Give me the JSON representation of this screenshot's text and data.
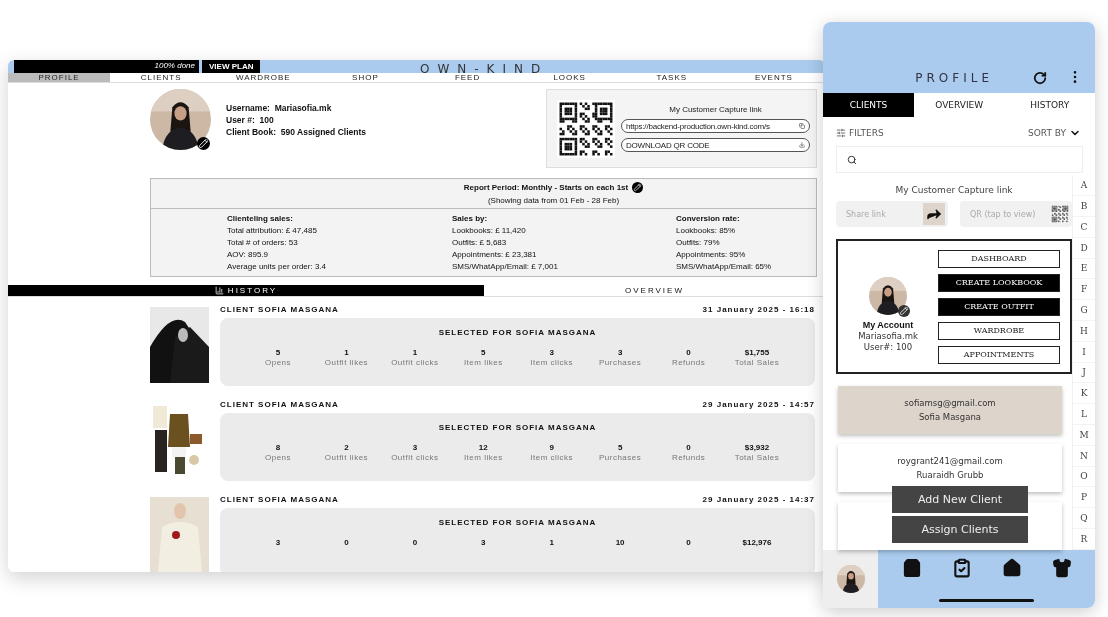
{
  "desktop": {
    "progress": {
      "label": "100% done",
      "level": 1
    },
    "view_plan": "VIEW PLAN",
    "logo": "OWN-KIND",
    "nav": [
      {
        "label": "PROFILE",
        "selected": true
      },
      {
        "label": "CLIENTS",
        "selected": false
      },
      {
        "label": "WARDROBE",
        "selected": false
      },
      {
        "label": "SHOP",
        "selected": false
      },
      {
        "label": "FEED",
        "selected": false
      },
      {
        "label": "LOOKS",
        "selected": false
      },
      {
        "label": "TASKS",
        "selected": false
      },
      {
        "label": "EVENTS",
        "selected": false
      }
    ],
    "profile": [
      {
        "label": "Username:",
        "value": "Mariasofia.mk"
      },
      {
        "label": "User #:",
        "value": "100"
      },
      {
        "label": "Client Book:",
        "value": "590 Assigned Clients"
      }
    ],
    "capture": {
      "title": "My Customer Capture link",
      "link": "https://backend-production.own-kind.com/s",
      "download": "DOWNLOAD QR CODE"
    },
    "report": {
      "period": "Report Period: Monthly - Starts on each 1st",
      "range": "(Showing data from 01 Feb - 28 Feb)",
      "columns": [
        {
          "title": "Clienteling sales:",
          "lines": [
            "Total attribution: £ 47,485",
            "Total # of orders: 53",
            "AOV:   895.9",
            "Average units per order: 3.4"
          ]
        },
        {
          "title": "Sales by:",
          "lines": [
            "Lookbooks: £ 11,420",
            "Outfits: £ 5,683",
            "Appointments: £ 23,381",
            "SMS/WhatApp/Email: £ 7,001"
          ]
        },
        {
          "title": "Conversion rate:",
          "lines": [
            "Lookbooks: 85%",
            "Outfits: 79%",
            "Appointments: 95%",
            "SMS/WhatApp/Email: 65%"
          ]
        }
      ]
    },
    "history_tabs": [
      {
        "label": "HISTORY",
        "selected": true
      },
      {
        "label": "OVERVIEW",
        "selected": false
      }
    ],
    "history": [
      {
        "client": "CLIENT SOFIA MASGANA",
        "date": "31 January 2025 - 16:18",
        "title": "SELECTED FOR SOFIA MASGANA",
        "stats": [
          {
            "value": "5",
            "label": "Opens"
          },
          {
            "value": "1",
            "label": "Outfit likes"
          },
          {
            "value": "1",
            "label": "Outfit clicks"
          },
          {
            "value": "5",
            "label": "Item likes"
          },
          {
            "value": "3",
            "label": "Item clicks"
          },
          {
            "value": "3",
            "label": "Purchases"
          },
          {
            "value": "0",
            "label": "Refunds"
          },
          {
            "value": "$1,755",
            "label": "Total Sales"
          }
        ]
      },
      {
        "client": "CLIENT SOFIA MASGANA",
        "date": "29 January 2025 - 14:57",
        "title": "SELECTED FOR SOFIA MASGANA",
        "stats": [
          {
            "value": "8",
            "label": "Opens"
          },
          {
            "value": "2",
            "label": "Outfit likes"
          },
          {
            "value": "3",
            "label": "Outfit clicks"
          },
          {
            "value": "12",
            "label": "Item likes"
          },
          {
            "value": "9",
            "label": "Item clicks"
          },
          {
            "value": "5",
            "label": "Purchases"
          },
          {
            "value": "0",
            "label": "Refunds"
          },
          {
            "value": "$3,932",
            "label": "Total Sales"
          }
        ]
      },
      {
        "client": "CLIENT SOFIA MASGANA",
        "date": "29 January 2025 - 14:37",
        "title": "SELECTED FOR SOFIA MASGANA",
        "stats": [
          {
            "value": "3"
          },
          {
            "value": "0"
          },
          {
            "value": "0"
          },
          {
            "value": "3"
          },
          {
            "value": "1"
          },
          {
            "value": "10"
          },
          {
            "value": "0"
          },
          {
            "value": "$12,976"
          }
        ]
      }
    ]
  },
  "phone": {
    "title": "PROFILE",
    "tabs": [
      {
        "label": "CLIENTS",
        "selected": true
      },
      {
        "label": "OVERVIEW",
        "selected": false
      },
      {
        "label": "HISTORY",
        "selected": false
      }
    ],
    "filters": "FILTERS",
    "sort": "SORT BY",
    "capture_title": "My Customer Capture link",
    "share": {
      "placeholder": "Share link"
    },
    "qr": {
      "placeholder": "QR (tap to view)"
    },
    "account": {
      "title": "My Account",
      "username": "Mariasofia.mk",
      "user": "User#: 100",
      "actions": [
        {
          "label": "DASHBOARD",
          "primary": false
        },
        {
          "label": "CREATE LOOKBOOK",
          "primary": true
        },
        {
          "label": "CREATE OUTFIT",
          "primary": true
        },
        {
          "label": "WARDROBE",
          "primary": false
        },
        {
          "label": "APPOINTMENTS",
          "primary": false
        }
      ]
    },
    "clients": [
      {
        "email": "sofiamsg@gmail.com",
        "name": "Sofia Masgana",
        "selected": true
      },
      {
        "email": "roygrant241@gmail.com",
        "name": "Ruaraidh Grubb",
        "selected": false
      },
      {
        "selected": false
      }
    ],
    "floating": [
      "Add New Client",
      "Assign Clients"
    ],
    "alphabet": [
      "A",
      "B",
      "C",
      "D",
      "E",
      "F",
      "G",
      "H",
      "I",
      "J",
      "K",
      "L",
      "M",
      "N",
      "O",
      "P",
      "Q",
      "R"
    ]
  }
}
